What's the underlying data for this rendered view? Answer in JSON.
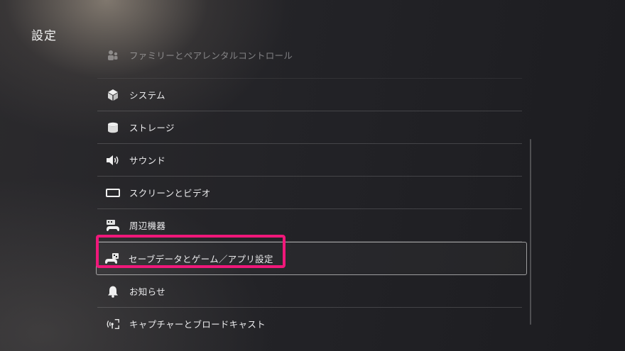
{
  "header": {
    "title": "設定"
  },
  "settings_list": {
    "items": [
      {
        "label": "ファミリーとペアレンタルコントロール",
        "icon": "family-icon"
      },
      {
        "label": "システム",
        "icon": "system-cube-icon"
      },
      {
        "label": "ストレージ",
        "icon": "storage-icon"
      },
      {
        "label": "サウンド",
        "icon": "speaker-icon"
      },
      {
        "label": "スクリーンとビデオ",
        "icon": "screen-icon"
      },
      {
        "label": "周辺機器",
        "icon": "accessories-icon"
      },
      {
        "label": "セーブデータとゲーム／アプリ設定",
        "icon": "saved-data-icon"
      },
      {
        "label": "お知らせ",
        "icon": "bell-icon"
      },
      {
        "label": "キャプチャーとブロードキャスト",
        "icon": "capture-icon"
      }
    ],
    "selected_index": 6
  },
  "colors": {
    "highlight": "#f0187a",
    "text": "#ececee",
    "divider": "rgba(255,255,255,0.16)"
  }
}
